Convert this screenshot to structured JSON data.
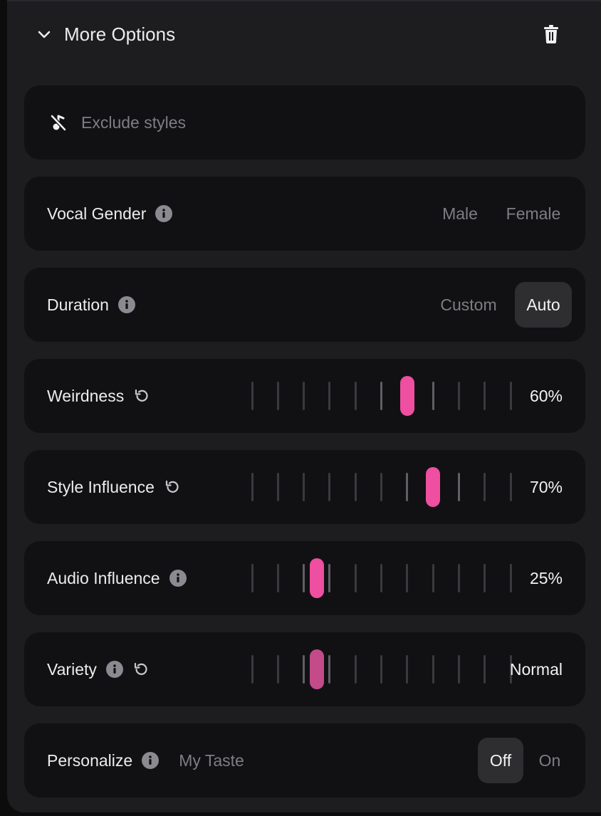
{
  "header": {
    "title": "More Options"
  },
  "exclude": {
    "placeholder": "Exclude styles"
  },
  "vocal_gender": {
    "label": "Vocal Gender",
    "options": [
      "Male",
      "Female"
    ]
  },
  "duration": {
    "label": "Duration",
    "options": [
      "Custom",
      "Auto"
    ],
    "selected": "Auto"
  },
  "sliders": [
    {
      "label": "Weirdness",
      "value_text": "60%",
      "value": 0.6,
      "has_info": false,
      "has_reset": true
    },
    {
      "label": "Style Influence",
      "value_text": "70%",
      "value": 0.7,
      "has_info": false,
      "has_reset": true
    },
    {
      "label": "Audio Influence",
      "value_text": "25%",
      "value": 0.25,
      "has_info": true,
      "has_reset": false
    },
    {
      "label": "Variety",
      "value_text": "Normal",
      "value": 0.25,
      "has_info": true,
      "has_reset": true
    }
  ],
  "personalize": {
    "label": "Personalize",
    "sub_label": "My Taste",
    "options": [
      "Off",
      "On"
    ],
    "selected": "Off"
  },
  "colors": {
    "accent": "#ee4fa0",
    "panel": "#1d1d20",
    "card": "#111113"
  }
}
